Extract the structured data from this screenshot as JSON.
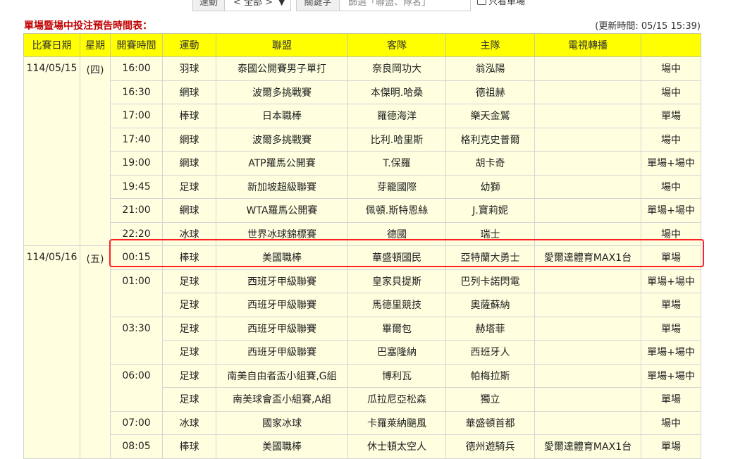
{
  "filters": {
    "sport_label": "運動",
    "sport_value": "< 全部 >",
    "keyword_label": "關鍵字",
    "keyword_placeholder": "篩選「聯盟、隊名」",
    "single_only": "只看單場"
  },
  "title": "單場暨場中投注預告時間表：",
  "updated": "(更新時間: 05/15 15:39)",
  "columns": [
    "比賽日期",
    "星期",
    "開賽時間",
    "運動",
    "聯盟",
    "客隊",
    "主隊",
    "電視轉播",
    ""
  ],
  "groups": [
    {
      "date": "114/05/15",
      "weekday": "(四)",
      "rows": [
        {
          "time": "16:00",
          "sport": "羽球",
          "league": "泰國公開賽男子單打",
          "away": "奈良岡功大",
          "home": "翁泓陽",
          "tv": "",
          "type": "場中"
        },
        {
          "time": "16:30",
          "sport": "網球",
          "league": "波爾多挑戰賽",
          "away": "本傑明.哈桑",
          "home": "德祖赫",
          "tv": "",
          "type": "場中"
        },
        {
          "time": "17:00",
          "sport": "棒球",
          "league": "日本職棒",
          "away": "羅德海洋",
          "home": "樂天金鷲",
          "tv": "",
          "type": "單場"
        },
        {
          "time": "17:40",
          "sport": "網球",
          "league": "波爾多挑戰賽",
          "away": "比利.哈里斯",
          "home": "格利克史普爾",
          "tv": "",
          "type": "場中"
        },
        {
          "time": "19:00",
          "sport": "網球",
          "league": "ATP羅馬公開賽",
          "away": "T.保羅",
          "home": "胡卡奇",
          "tv": "",
          "type": "單場+場中"
        },
        {
          "time": "19:45",
          "sport": "足球",
          "league": "新加坡超級聯賽",
          "away": "芽籠國際",
          "home": "幼獅",
          "tv": "",
          "type": "場中"
        },
        {
          "time": "21:00",
          "sport": "網球",
          "league": "WTA羅馬公開賽",
          "away": "佩頓.斯特恩絲",
          "home": "J.寶莉妮",
          "tv": "",
          "type": "單場+場中"
        },
        {
          "time": "22:20",
          "sport": "冰球",
          "league": "世界冰球錦標賽",
          "away": "德國",
          "home": "瑞士",
          "tv": "",
          "type": "場中"
        }
      ]
    },
    {
      "date": "114/05/16",
      "weekday": "(五)",
      "rows": [
        {
          "time": "00:15",
          "sport": "棒球",
          "league": "美國職棒",
          "away": "華盛頓國民",
          "home": "亞特蘭大勇士",
          "tv": "愛爾達體育MAX1台",
          "type": "單場"
        },
        {
          "time": "01:00",
          "sport": "足球",
          "league": "西班牙甲級聯賽",
          "away": "皇家貝提斯",
          "home": "巴列卡諾閃電",
          "tv": "",
          "type": "單場+場中"
        },
        {
          "time": "",
          "sport": "足球",
          "league": "西班牙甲級聯賽",
          "away": "馬德里競技",
          "home": "奧薩蘇納",
          "tv": "",
          "type": "單場"
        },
        {
          "time": "03:30",
          "sport": "足球",
          "league": "西班牙甲級聯賽",
          "away": "畢爾包",
          "home": "赫塔菲",
          "tv": "",
          "type": "單場"
        },
        {
          "time": "",
          "sport": "足球",
          "league": "西班牙甲級聯賽",
          "away": "巴塞隆納",
          "home": "西班牙人",
          "tv": "",
          "type": "單場+場中"
        },
        {
          "time": "06:00",
          "sport": "足球",
          "league": "南美自由者盃小組賽,G組",
          "away": "博利瓦",
          "home": "帕梅拉斯",
          "tv": "",
          "type": "單場+場中"
        },
        {
          "time": "",
          "sport": "足球",
          "league": "南美球會盃小組賽,A組",
          "away": "瓜拉尼亞松森",
          "home": "獨立",
          "tv": "",
          "type": "單場"
        },
        {
          "time": "07:00",
          "sport": "冰球",
          "league": "國家冰球",
          "away": "卡羅萊納颶風",
          "home": "華盛頓首都",
          "tv": "",
          "type": "場中"
        },
        {
          "time": "08:05",
          "sport": "棒球",
          "league": "美國職棒",
          "away": "休士頓太空人",
          "home": "德州遊騎兵",
          "tv": "愛爾達體育MAX1台",
          "type": "單場"
        }
      ]
    }
  ],
  "colors": {
    "header_bg": "#ffff00",
    "row_bg": "#ffffe0",
    "title": "#c00000",
    "highlight": "#ff2020"
  }
}
